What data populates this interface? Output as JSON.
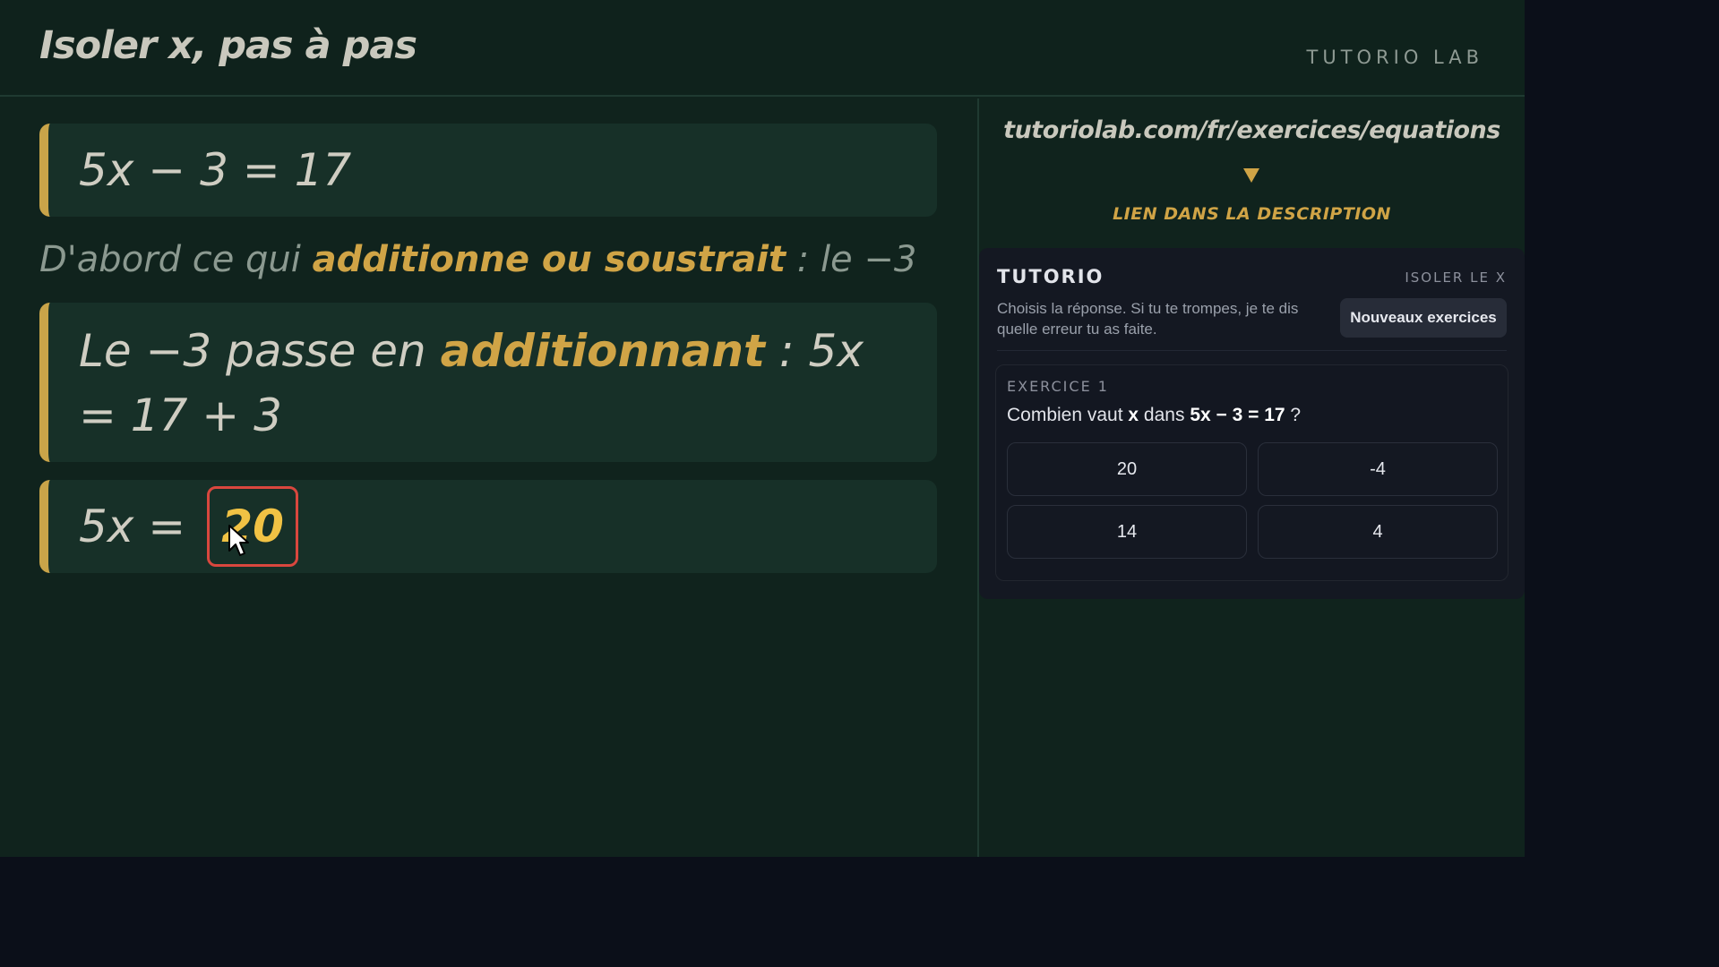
{
  "header": {
    "title": "Isoler x, pas à pas",
    "brand": "TUTORIO LAB"
  },
  "board": {
    "step1": "5x − 3 = 17",
    "explain": {
      "before": "D'abord ce qui ",
      "highlight": "additionne ou soustrait",
      "after": " : le −3"
    },
    "step2": {
      "before": "Le −3 passe en ",
      "highlight": "additionnant",
      "after": " : 5x = 17 + 3"
    },
    "step3": {
      "prefix": "5x = ",
      "answer": "20"
    }
  },
  "promo": {
    "url": "tutoriolab.com/fr/exercices/equations",
    "note": "LIEN DANS LA DESCRIPTION"
  },
  "widget": {
    "brand": "TUTORIO",
    "topic": "ISOLER LE X",
    "description": "Choisis la réponse. Si tu te trompes, je te dis quelle erreur tu as faite.",
    "new_button": "Nouveaux exercices",
    "exercise": {
      "label": "EXERCICE 1",
      "question_prefix": "Combien vaut ",
      "question_var": "x",
      "question_mid": " dans ",
      "question_eq": "5x − 3 = 17",
      "question_suffix": " ?",
      "options": [
        "20",
        "-4",
        "14",
        "4"
      ]
    }
  },
  "colors": {
    "board_bg": "#10231d",
    "accent_gold": "#d0a446",
    "answer_border": "#d9473e",
    "answer_text": "#f1c244",
    "widget_bg": "#141822"
  }
}
